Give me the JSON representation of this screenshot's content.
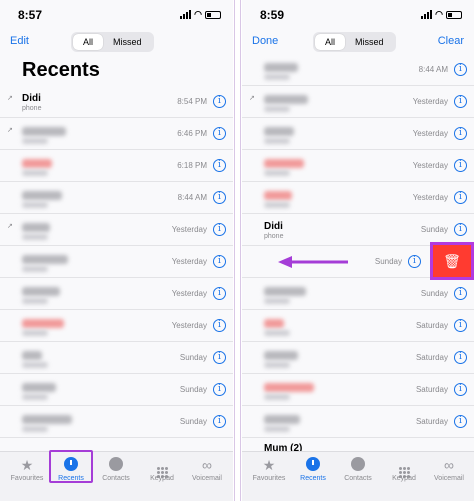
{
  "left": {
    "status_time": "8:57",
    "nav": {
      "edit": "Edit",
      "seg_all": "All",
      "seg_missed": "Missed"
    },
    "title": "Recents",
    "rows": [
      {
        "name": "Didi",
        "sub": "phone",
        "time": "8:54 PM",
        "outgoing": true,
        "blur": false
      },
      {
        "time": "6:46 PM",
        "outgoing": true,
        "blur": true,
        "red": false
      },
      {
        "time": "6:18 PM",
        "outgoing": false,
        "blur": true,
        "red": true
      },
      {
        "time": "8:44 AM",
        "outgoing": false,
        "blur": true,
        "red": false
      },
      {
        "time": "Yesterday",
        "outgoing": true,
        "blur": true,
        "red": false
      },
      {
        "time": "Yesterday",
        "outgoing": false,
        "blur": true,
        "red": false
      },
      {
        "time": "Yesterday",
        "outgoing": false,
        "blur": true,
        "red": false
      },
      {
        "time": "Yesterday",
        "outgoing": false,
        "blur": true,
        "red": true
      },
      {
        "time": "Sunday",
        "outgoing": false,
        "blur": true,
        "red": false
      },
      {
        "time": "Sunday",
        "outgoing": false,
        "blur": true,
        "red": false
      },
      {
        "time": "Sunday",
        "outgoing": false,
        "blur": true,
        "red": false
      }
    ],
    "tabs": [
      "Favourites",
      "Recents",
      "Contacts",
      "Keypad",
      "Voicemail"
    ]
  },
  "right": {
    "status_time": "8:59",
    "nav": {
      "done": "Done",
      "seg_all": "All",
      "seg_missed": "Missed",
      "clear": "Clear"
    },
    "rows": [
      {
        "time": "8:44 AM",
        "outgoing": false,
        "blur": true,
        "red": false
      },
      {
        "time": "Yesterday",
        "outgoing": true,
        "blur": true,
        "red": false
      },
      {
        "time": "Yesterday",
        "outgoing": false,
        "blur": true,
        "red": false
      },
      {
        "time": "Yesterday",
        "outgoing": false,
        "blur": true,
        "red": true
      },
      {
        "time": "Yesterday",
        "outgoing": false,
        "blur": true,
        "red": true
      },
      {
        "name": "Didi",
        "sub": "phone",
        "time": "Sunday",
        "outgoing": false,
        "blur": false
      },
      {
        "time": "Sunday",
        "outgoing": false,
        "swiped": true
      },
      {
        "time": "Sunday",
        "outgoing": false,
        "blur": true,
        "red": false
      },
      {
        "time": "Saturday",
        "outgoing": false,
        "blur": true,
        "red": true
      },
      {
        "time": "Saturday",
        "outgoing": false,
        "blur": true,
        "red": false
      },
      {
        "time": "Saturday",
        "outgoing": false,
        "blur": true,
        "red": true
      },
      {
        "time": "Saturday",
        "outgoing": false,
        "blur": true,
        "red": false
      }
    ],
    "partial_row_name": "Mum (2)",
    "tabs": [
      "Favourites",
      "Recents",
      "Contacts",
      "Keypad",
      "Voicemail"
    ]
  },
  "icons": {
    "delete": "trash-icon",
    "arrow": "swipe-left-arrow-icon"
  },
  "colors": {
    "accent": "#1a73e8",
    "missed": "#ff3b30",
    "annotation": "#a53dd7"
  }
}
